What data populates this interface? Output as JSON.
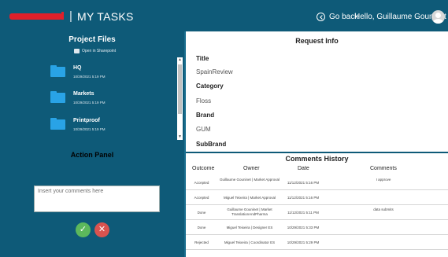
{
  "header": {
    "title": "MY TASKS",
    "separator": "|",
    "go_back_label": "Go back",
    "greeting": "Hello, Guillaume Gouninet"
  },
  "colors": {
    "header_bg": "#0e5a78",
    "folder": "#29a3e6",
    "approve": "#5cb85c",
    "reject": "#d9534f",
    "redaction": "#e0202a"
  },
  "project_files": {
    "title": "Project Files",
    "sharepoint_link": "Open in Sharepoint",
    "items": [
      {
        "name": "HQ",
        "date": "10/29/2021 5:19 PM",
        "icon": "folder-icon"
      },
      {
        "name": "Markets",
        "date": "10/29/2021 5:19 PM",
        "icon": "folder-icon"
      },
      {
        "name": "Printproof",
        "date": "10/29/2021 5:19 PM",
        "icon": "folder-icon"
      }
    ]
  },
  "action_panel": {
    "title": "Action Panel",
    "comment_placeholder": "Insert your comments here",
    "approve_icon": "check-icon",
    "reject_icon": "close-icon"
  },
  "request_info": {
    "title": "Request Info",
    "fields": [
      {
        "label": "Title",
        "value": "SpainReview"
      },
      {
        "label": "Category",
        "value": "Floss"
      },
      {
        "label": "Brand",
        "value": "GUM"
      },
      {
        "label": "SubBrand",
        "value": ""
      }
    ]
  },
  "comments_history": {
    "title": "Comments History",
    "columns": [
      "Outcome",
      "Owner",
      "Date",
      "Comments"
    ],
    "rows": [
      {
        "outcome": "Accepted",
        "owner": "Guillaume Gouninet | Market Approval",
        "date": "11/12/2021 5:16 PM",
        "comments": "I approve"
      },
      {
        "outcome": "Accepted",
        "owner": "Miguel Teixeira | Market Approval",
        "date": "11/12/2021 5:16 PM",
        "comments": ""
      },
      {
        "outcome": "Done",
        "owner": "Guillaume Gouninet | Market TranslationAndPharma",
        "date": "11/12/2021 5:11 PM",
        "comments": "data submits"
      },
      {
        "outcome": "Done",
        "owner": "Miguel Teixeira | Designer ES",
        "date": "10/29/2021 5:33 PM",
        "comments": ""
      },
      {
        "outcome": "Rejected",
        "owner": "Miguel Teixeira | Coordinator ES",
        "date": "10/29/2021 5:29 PM",
        "comments": ""
      }
    ]
  }
}
